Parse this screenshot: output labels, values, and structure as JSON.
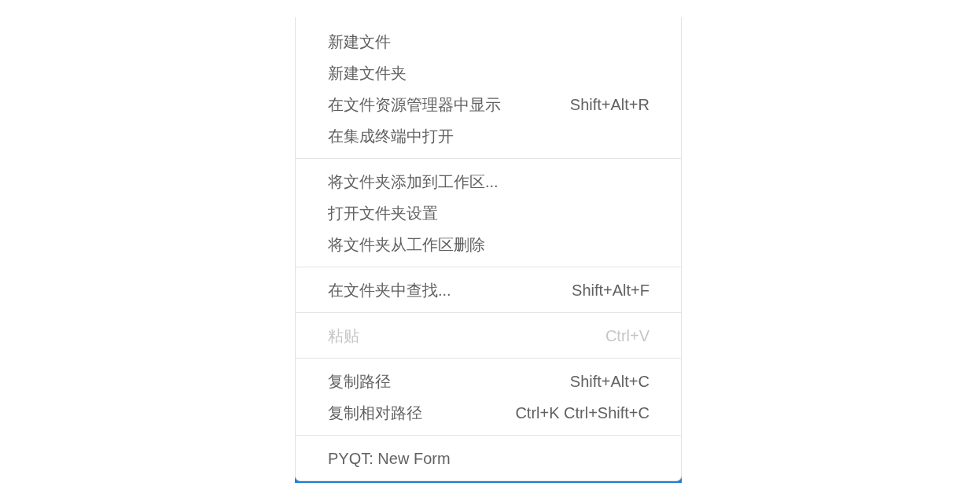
{
  "context_menu": {
    "groups": [
      {
        "items": [
          {
            "label": "新建文件",
            "disabled": false
          },
          {
            "label": "新建文件夹",
            "disabled": false
          },
          {
            "label": "在文件资源管理器中显示",
            "shortcut": "Shift+Alt+R",
            "disabled": false
          },
          {
            "label": "在集成终端中打开",
            "disabled": false
          }
        ]
      },
      {
        "items": [
          {
            "label": "将文件夹添加到工作区...",
            "disabled": false
          },
          {
            "label": "打开文件夹设置",
            "disabled": false
          },
          {
            "label": "将文件夹从工作区删除",
            "disabled": false
          }
        ]
      },
      {
        "items": [
          {
            "label": "在文件夹中查找...",
            "shortcut": "Shift+Alt+F",
            "disabled": false
          }
        ]
      },
      {
        "items": [
          {
            "label": "粘贴",
            "shortcut": "Ctrl+V",
            "disabled": true
          }
        ]
      },
      {
        "items": [
          {
            "label": "复制路径",
            "shortcut": "Shift+Alt+C",
            "disabled": false
          },
          {
            "label": "复制相对路径",
            "shortcut": "Ctrl+K Ctrl+Shift+C",
            "disabled": false
          }
        ]
      },
      {
        "items": [
          {
            "label": "PYQT: New Form",
            "disabled": false
          }
        ]
      }
    ]
  }
}
